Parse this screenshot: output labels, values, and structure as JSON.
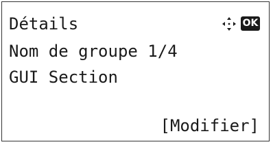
{
  "screen": {
    "title": "Détails",
    "line2": "Nom de groupe 1/4",
    "line3": "GUI Section",
    "softkey_label": "[Modifier]"
  },
  "indicators": {
    "nav_icon": "four-way-arrow-icon",
    "ok_icon_label": "OK"
  }
}
